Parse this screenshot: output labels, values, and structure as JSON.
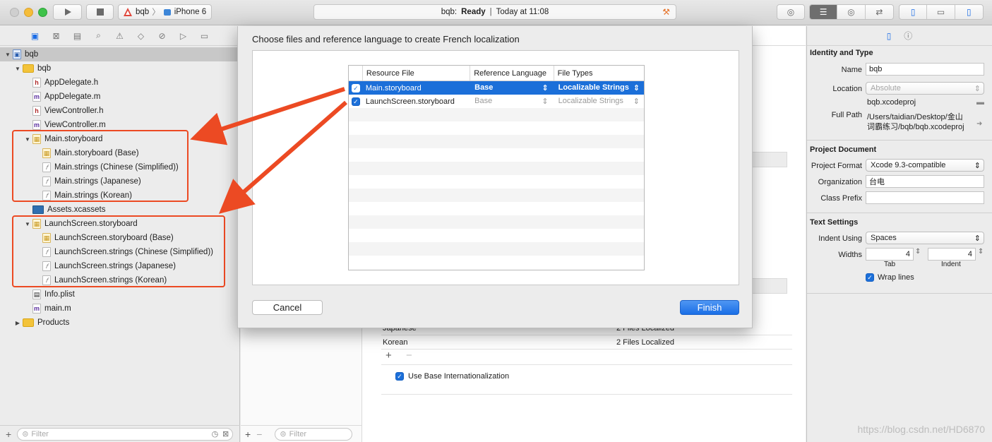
{
  "toolbar": {
    "scheme_target": "bqb",
    "scheme_device": "iPhone 6",
    "activity_project": "bqb:",
    "activity_status": "Ready",
    "activity_separator": "|",
    "activity_time": "Today at 11:08"
  },
  "navigator": {
    "items": [
      {
        "label": "bqb",
        "indent": 0,
        "icon": "proj",
        "disclosure": "open",
        "selected": true
      },
      {
        "label": "bqb",
        "indent": 1,
        "icon": "folder",
        "disclosure": "open"
      },
      {
        "label": "AppDelegate.h",
        "indent": 2,
        "icon": "h"
      },
      {
        "label": "AppDelegate.m",
        "indent": 2,
        "icon": "m"
      },
      {
        "label": "ViewController.h",
        "indent": 2,
        "icon": "h"
      },
      {
        "label": "ViewController.m",
        "indent": 2,
        "icon": "m"
      },
      {
        "label": "Main.storyboard",
        "indent": 2,
        "icon": "sb",
        "disclosure": "open"
      },
      {
        "label": "Main.storyboard (Base)",
        "indent": 3,
        "icon": "sb"
      },
      {
        "label": "Main.strings (Chinese (Simplified))",
        "indent": 3,
        "icon": "str"
      },
      {
        "label": "Main.strings (Japanese)",
        "indent": 3,
        "icon": "str"
      },
      {
        "label": "Main.strings (Korean)",
        "indent": 3,
        "icon": "str"
      },
      {
        "label": "Assets.xcassets",
        "indent": 2,
        "icon": "assets"
      },
      {
        "label": "LaunchScreen.storyboard",
        "indent": 2,
        "icon": "sb",
        "disclosure": "open"
      },
      {
        "label": "LaunchScreen.storyboard (Base)",
        "indent": 3,
        "icon": "sb"
      },
      {
        "label": "LaunchScreen.strings (Chinese (Simplified))",
        "indent": 3,
        "icon": "str"
      },
      {
        "label": "LaunchScreen.strings (Japanese)",
        "indent": 3,
        "icon": "str"
      },
      {
        "label": "LaunchScreen.strings (Korean)",
        "indent": 3,
        "icon": "str"
      },
      {
        "label": "Info.plist",
        "indent": 2,
        "icon": "plist"
      },
      {
        "label": "main.m",
        "indent": 2,
        "icon": "m"
      },
      {
        "label": "Products",
        "indent": 1,
        "icon": "folder",
        "disclosure": "closed"
      }
    ],
    "filter_placeholder": "Filter"
  },
  "editor": {
    "rows": [
      {
        "language": "Japanese",
        "files": "2 Files Localized"
      },
      {
        "language": "Korean",
        "files": "2 Files Localized"
      }
    ],
    "use_base_label": "Use Base Internationalization",
    "filter_placeholder": "Filter"
  },
  "sheet": {
    "title": "Choose files and reference language to create French localization",
    "columns": [
      "Resource File",
      "Reference Language",
      "File Types"
    ],
    "rows": [
      {
        "file": "Main.storyboard",
        "language": "Base",
        "type": "Localizable Strings",
        "checked": true,
        "selected": true
      },
      {
        "file": "LaunchScreen.storyboard",
        "language": "Base",
        "type": "Localizable Strings",
        "checked": true,
        "selected": false
      }
    ],
    "cancel_label": "Cancel",
    "finish_label": "Finish"
  },
  "inspector": {
    "identity_title": "Identity and Type",
    "name_label": "Name",
    "name_value": "bqb",
    "location_label": "Location",
    "location_value": "Absolute",
    "location_file": "bqb.xcodeproj",
    "fullpath_label": "Full Path",
    "fullpath_value_1": "/Users/taidian/Desktop/金山",
    "fullpath_value_2": "词霸练习/bqb/bqb.xcodeproj",
    "project_doc_title": "Project Document",
    "format_label": "Project Format",
    "format_value": "Xcode 9.3-compatible",
    "org_label": "Organization",
    "org_value": "台电",
    "prefix_label": "Class Prefix",
    "prefix_value": "",
    "text_settings_title": "Text Settings",
    "indent_using_label": "Indent Using",
    "indent_using_value": "Spaces",
    "widths_label": "Widths",
    "tab_value": "4",
    "indent_value": "4",
    "tab_label": "Tab",
    "indent_label": "Indent",
    "wrap_label": "Wrap lines"
  },
  "watermark": "https://blog.csdn.net/HD6870",
  "colors": {
    "accent": "#1b6fd9",
    "annotation": "#ec4a23"
  }
}
